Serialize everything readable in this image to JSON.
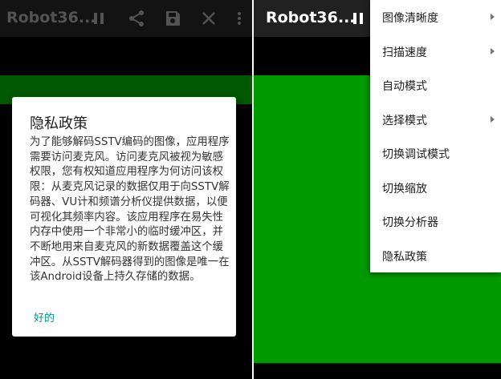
{
  "left_screen": {
    "app_title": "Robot36...",
    "icons": [
      "pause-icon",
      "share-icon",
      "save-icon",
      "close-icon",
      "more-vert-icon"
    ]
  },
  "right_screen": {
    "app_title": "Robot36...",
    "icons": [
      "pause-icon"
    ]
  },
  "dialog": {
    "title": "隐私政策",
    "body": "为了能够解码SSTV编码的图像，应用程序需要访问麦克风。访问麦克风被视为敏感权限，您有权知道应用程序为何访问该权限：从麦克风记录的数据仅用于向SSTV解码器、VU计和频谱分析仪提供数据，以便可视化其频率内容。该应用程序在易失性内存中使用一个非常小的临时缓冲区，并不断地用来自麦克风的新数据覆盖这个缓冲区。从SSTV解码器得到的图像是唯一在该Android设备上持久存储的数据。",
    "ok": "好的"
  },
  "menu": {
    "items": [
      {
        "label": "图像清晰度",
        "submenu": true
      },
      {
        "label": "扫描速度",
        "submenu": true
      },
      {
        "label": "自动模式",
        "submenu": false
      },
      {
        "label": "选择模式",
        "submenu": true
      },
      {
        "label": "切换调试模式",
        "submenu": false
      },
      {
        "label": "切换缩放",
        "submenu": false
      },
      {
        "label": "切换分析器",
        "submenu": false
      },
      {
        "label": "隐私政策",
        "submenu": false
      }
    ]
  },
  "colors": {
    "signal_green": "#009900",
    "toolbar": "#212121",
    "accent": "#009688"
  }
}
